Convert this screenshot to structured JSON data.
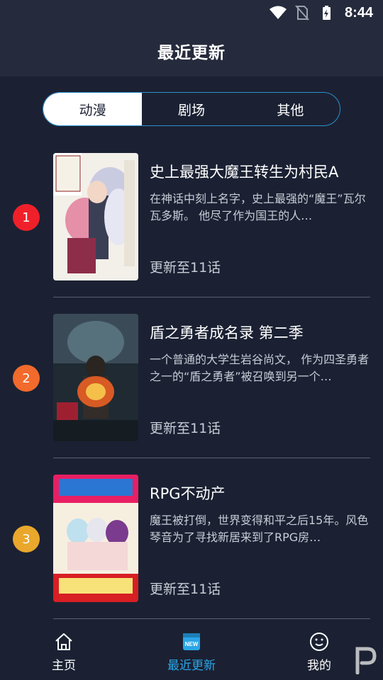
{
  "status_bar": {
    "time": "8:44"
  },
  "header": {
    "title": "最近更新"
  },
  "tabs": [
    {
      "label": "动漫",
      "active": true
    },
    {
      "label": "剧场",
      "active": false
    },
    {
      "label": "其他",
      "active": false
    }
  ],
  "items": [
    {
      "rank": "1",
      "rank_color": "#f0202a",
      "title": "史上最强大魔王转生为村民A",
      "description": "在神话中刻上名字，史上最强的“魔王”瓦尔瓦多斯。 他尽了作为国王的人…",
      "update": "更新至11话"
    },
    {
      "rank": "2",
      "rank_color": "#f26a2c",
      "title": "盾之勇者成名录 第二季",
      "description": "一个普通的大学生岩谷尚文， 作为四圣勇者之一的“盾之勇者”被召唤到另一个…",
      "update": "更新至11话"
    },
    {
      "rank": "3",
      "rank_color": "#e9a72c",
      "title": "RPG不动产",
      "description": "魔王被打倒，世界变得和平之后15年。风色琴音为了寻找新居来到了RPG房…",
      "update": "更新至11话"
    }
  ],
  "bottom_nav": [
    {
      "label": "主页",
      "icon": "home-icon",
      "active": false
    },
    {
      "label": "最近更新",
      "icon": "new-badge-icon",
      "active": true
    },
    {
      "label": "我的",
      "icon": "smile-face-icon",
      "active": false
    }
  ],
  "colors": {
    "accent": "#2ba6e8",
    "background": "#1b2133",
    "header": "#252b3c"
  }
}
